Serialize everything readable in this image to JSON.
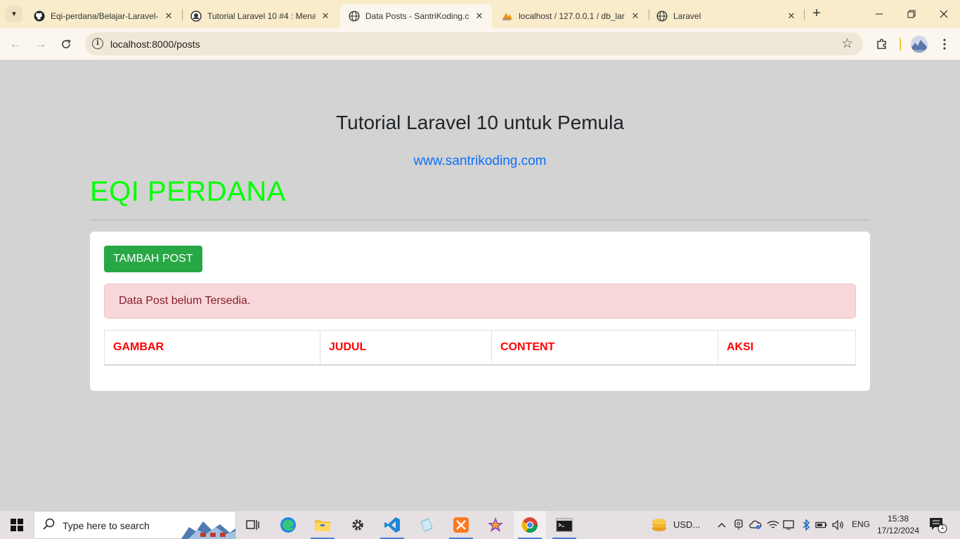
{
  "browser": {
    "tabs": [
      {
        "title": "Eqi-perdana/Belajar-Laravel-",
        "favicon": "github-icon",
        "active": false
      },
      {
        "title": "Tutorial Laravel 10 #4 : Mena",
        "favicon": "santrikoding-icon",
        "active": false
      },
      {
        "title": "Data Posts - SantriKoding.co",
        "favicon": "globe-icon",
        "active": true
      },
      {
        "title": "localhost / 127.0.0.1 / db_lar",
        "favicon": "phpmyadmin-icon",
        "active": false
      },
      {
        "title": "Laravel",
        "favicon": "globe-icon",
        "active": false
      }
    ],
    "address": "localhost:8000/posts",
    "accent": "#f8eccb"
  },
  "page": {
    "header_title": "Tutorial Laravel 10 untuk Pemula",
    "header_link": "www.santrikoding.com",
    "author_name": "EQI PERDANA",
    "add_button_label": "TAMBAH POST",
    "alert_text": "Data Post belum Tersedia.",
    "table_headers": [
      "GAMBAR",
      "JUDUL",
      "CONTENT",
      "AKSI"
    ],
    "colors": {
      "name": "#00ff00",
      "link": "#0d6efd",
      "button": "#28a745",
      "alert_bg": "#f8d7da",
      "table_header": "#ff0000",
      "background": "#d3d3d3"
    }
  },
  "taskbar": {
    "search_placeholder": "Type here to search",
    "weather_text": "USD...",
    "language": "ENG",
    "time": "15:38",
    "date": "17/12/2024",
    "notification_count": "1"
  }
}
